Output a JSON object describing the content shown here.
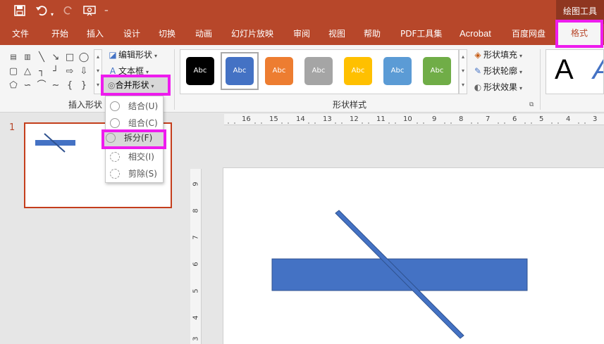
{
  "qat": {
    "save_icon": "save-icon",
    "undo_icon": "undo-icon",
    "redo_icon": "redo-icon",
    "present_icon": "present-icon"
  },
  "title_bar": {
    "contextual": "绘图工具"
  },
  "tabs": [
    {
      "label": "文件"
    },
    {
      "label": "开始"
    },
    {
      "label": "插入"
    },
    {
      "label": "设计"
    },
    {
      "label": "切换"
    },
    {
      "label": "动画"
    },
    {
      "label": "幻灯片放映"
    },
    {
      "label": "审阅"
    },
    {
      "label": "视图"
    },
    {
      "label": "帮助"
    },
    {
      "label": "PDF工具集"
    },
    {
      "label": "Acrobat"
    },
    {
      "label": "百度网盘"
    },
    {
      "label": "格式"
    }
  ],
  "ribbon": {
    "edit_shape": "编辑形状",
    "text_box": "文本框",
    "merge_shapes": "合并形状",
    "insert_shapes_group": "插入形状",
    "shape_styles_group": "形状样式",
    "style_samples": [
      {
        "label": "Abc",
        "color": "#000000"
      },
      {
        "label": "Abc",
        "color": "#4472c4"
      },
      {
        "label": "Abc",
        "color": "#ed7d31"
      },
      {
        "label": "Abc",
        "color": "#a5a5a5"
      },
      {
        "label": "Abc",
        "color": "#ffc000"
      },
      {
        "label": "Abc",
        "color": "#5b9bd5"
      },
      {
        "label": "Abc",
        "color": "#70ad47"
      }
    ],
    "shape_fill": "形状填充",
    "shape_outline": "形状轮廓",
    "shape_effects": "形状效果",
    "wordart_letter": "A"
  },
  "merge_menu": {
    "items": [
      {
        "label": "结合(U)"
      },
      {
        "label": "组合(C)"
      },
      {
        "label": "拆分(F)"
      },
      {
        "label": "相交(I)"
      },
      {
        "label": "剪除(S)"
      }
    ]
  },
  "slides_panel": {
    "slide_number": "1"
  },
  "ruler": {
    "horizontal": [
      "16",
      "15",
      "14",
      "13",
      "12",
      "11",
      "10",
      "9",
      "8",
      "7",
      "6",
      "5",
      "4",
      "3"
    ],
    "vertical": [
      "9",
      "8",
      "7",
      "6",
      "5",
      "4",
      "3"
    ]
  },
  "colors": {
    "accent": "#b7472a",
    "highlight": "#ee1cee",
    "shape": "#4472c4"
  }
}
